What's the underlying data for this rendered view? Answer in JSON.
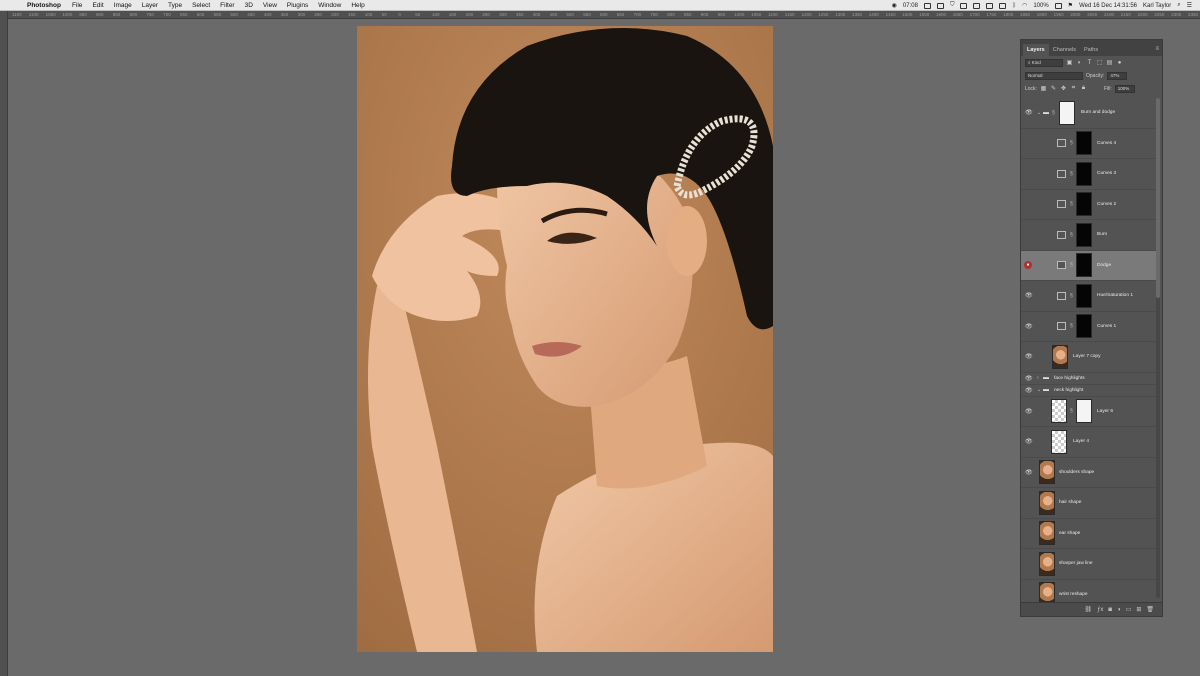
{
  "menubar": {
    "apple": "",
    "app": "Photoshop",
    "items": [
      "File",
      "Edit",
      "Image",
      "Layer",
      "Type",
      "Select",
      "Filter",
      "3D",
      "View",
      "Plugins",
      "Window",
      "Help"
    ],
    "status": {
      "time_small": "07:08",
      "battery": "100%",
      "datetime": "Wed 16 Dec 14:31:56",
      "user": "Karl Taylor"
    }
  },
  "ruler_top": [
    "1160",
    "1100",
    "1050",
    "1000",
    "950",
    "900",
    "850",
    "800",
    "750",
    "700",
    "650",
    "600",
    "550",
    "500",
    "450",
    "400",
    "350",
    "300",
    "250",
    "200",
    "150",
    "100",
    "50",
    "0",
    "50",
    "100",
    "150",
    "200",
    "250",
    "300",
    "350",
    "400",
    "450",
    "500",
    "550",
    "600",
    "650",
    "700",
    "750",
    "800",
    "850",
    "900",
    "950",
    "1000",
    "1050",
    "1100",
    "1150",
    "1200",
    "1250",
    "1300",
    "1350",
    "1400",
    "1450",
    "1500",
    "1550",
    "1600",
    "1650",
    "1700",
    "1750",
    "1800",
    "1850",
    "1900",
    "1950",
    "2000",
    "2050",
    "2100",
    "2150",
    "2200",
    "2250",
    "2300",
    "2350",
    "2400",
    "2450"
  ],
  "panel": {
    "tabs": [
      "Layers",
      "Channels",
      "Paths"
    ],
    "kind": "Kind",
    "blend_mode": "Normal",
    "opacity_label": "Opacity:",
    "opacity_value": "47%",
    "lock_label": "Lock:",
    "fill_label": "Fill:",
    "fill_value": "100%"
  },
  "layers": [
    {
      "name": "Burn and dodge",
      "type": "group",
      "visible": true
    },
    {
      "name": "Curves 4",
      "type": "adjustment",
      "visible": false
    },
    {
      "name": "Curves 3",
      "type": "adjustment",
      "visible": false
    },
    {
      "name": "Curves 2",
      "type": "adjustment",
      "visible": false
    },
    {
      "name": "Burn",
      "type": "adjustment",
      "visible": false
    },
    {
      "name": "Dodge",
      "type": "adjustment",
      "visible": true,
      "selected": true
    },
    {
      "name": "Hue/Saturation 1",
      "type": "adjustment",
      "visible": true
    },
    {
      "name": "Curves 1",
      "type": "adjustment",
      "visible": true
    },
    {
      "name": "Layer 7 copy",
      "type": "pixel",
      "visible": true
    },
    {
      "name": "face highlights",
      "type": "folder",
      "visible": true
    },
    {
      "name": "neck highlight",
      "type": "folder",
      "visible": true
    },
    {
      "name": "Layer 6",
      "type": "pixel-mask",
      "visible": true
    },
    {
      "name": "Layer 4",
      "type": "transparent",
      "visible": true
    },
    {
      "name": "shoulders shape",
      "type": "pixel",
      "visible": true
    },
    {
      "name": "hair shape",
      "type": "pixel",
      "visible": false
    },
    {
      "name": "ear shape",
      "type": "pixel",
      "visible": false
    },
    {
      "name": "sharper jaw line",
      "type": "pixel",
      "visible": false
    },
    {
      "name": "wrist reshape",
      "type": "pixel",
      "visible": false
    }
  ]
}
